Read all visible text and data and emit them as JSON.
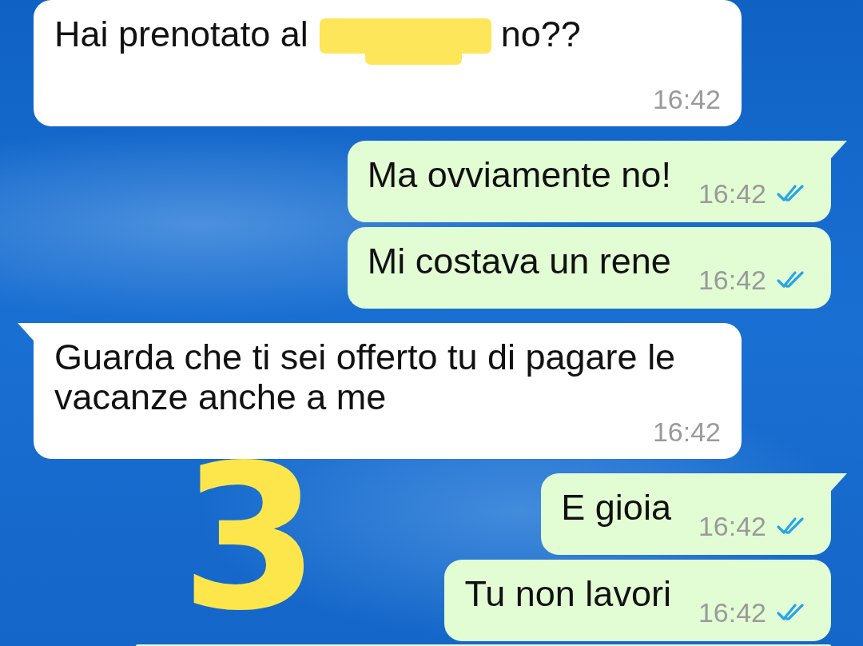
{
  "messages": [
    {
      "kind": "incoming",
      "tail": false,
      "text_before": "Hai prenotato al",
      "redacted": true,
      "text_after": "no??",
      "time": "16:42"
    },
    {
      "kind": "outgoing",
      "tail": true,
      "text": "Ma ovviamente no!",
      "time": "16:42",
      "read": true
    },
    {
      "kind": "outgoing",
      "tail": false,
      "text": "Mi costava un rene",
      "time": "16:42",
      "read": true
    },
    {
      "kind": "incoming",
      "tail": true,
      "text": "Guarda che ti sei offerto tu di pagare le vacanze anche a me",
      "time": "16:42"
    },
    {
      "kind": "outgoing",
      "tail": true,
      "text": "E gioia",
      "time": "16:42",
      "read": true
    },
    {
      "kind": "outgoing",
      "tail": false,
      "text": "Tu non lavori",
      "time": "16:42",
      "read": true
    },
    {
      "kind": "partial"
    }
  ],
  "annotation": {
    "text": "3"
  }
}
